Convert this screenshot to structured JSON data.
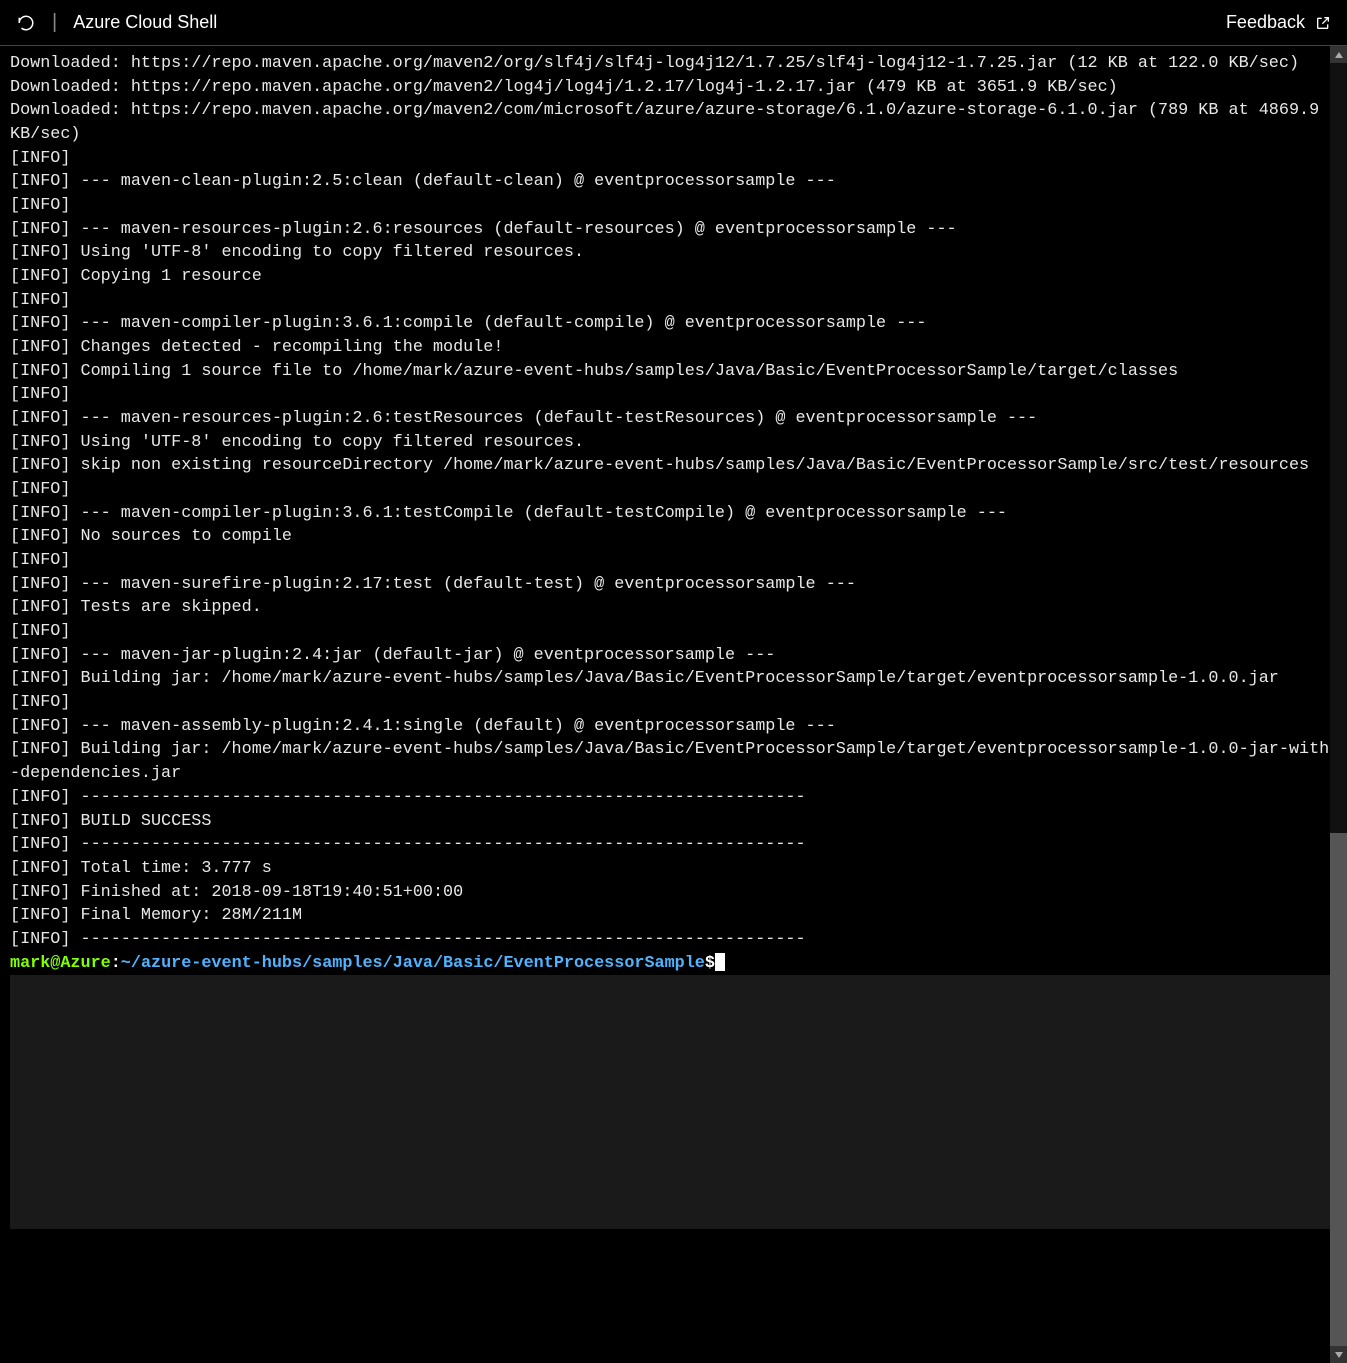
{
  "header": {
    "title": "Azure Cloud Shell",
    "feedback_label": "Feedback"
  },
  "terminal": {
    "lines": [
      "Downloaded: https://repo.maven.apache.org/maven2/org/slf4j/slf4j-log4j12/1.7.25/slf4j-log4j12-1.7.25.jar (12 KB at 122.0 KB/sec)",
      "Downloaded: https://repo.maven.apache.org/maven2/log4j/log4j/1.2.17/log4j-1.2.17.jar (479 KB at 3651.9 KB/sec)",
      "Downloaded: https://repo.maven.apache.org/maven2/com/microsoft/azure/azure-storage/6.1.0/azure-storage-6.1.0.jar (789 KB at 4869.9 KB/sec)",
      "[INFO]",
      "[INFO] --- maven-clean-plugin:2.5:clean (default-clean) @ eventprocessorsample ---",
      "[INFO]",
      "[INFO] --- maven-resources-plugin:2.6:resources (default-resources) @ eventprocessorsample ---",
      "[INFO] Using 'UTF-8' encoding to copy filtered resources.",
      "[INFO] Copying 1 resource",
      "[INFO]",
      "[INFO] --- maven-compiler-plugin:3.6.1:compile (default-compile) @ eventprocessorsample ---",
      "[INFO] Changes detected - recompiling the module!",
      "[INFO] Compiling 1 source file to /home/mark/azure-event-hubs/samples/Java/Basic/EventProcessorSample/target/classes",
      "[INFO]",
      "[INFO] --- maven-resources-plugin:2.6:testResources (default-testResources) @ eventprocessorsample ---",
      "[INFO] Using 'UTF-8' encoding to copy filtered resources.",
      "[INFO] skip non existing resourceDirectory /home/mark/azure-event-hubs/samples/Java/Basic/EventProcessorSample/src/test/resources",
      "[INFO]",
      "[INFO] --- maven-compiler-plugin:3.6.1:testCompile (default-testCompile) @ eventprocessorsample ---",
      "[INFO] No sources to compile",
      "[INFO]",
      "[INFO] --- maven-surefire-plugin:2.17:test (default-test) @ eventprocessorsample ---",
      "[INFO] Tests are skipped.",
      "[INFO]",
      "[INFO] --- maven-jar-plugin:2.4:jar (default-jar) @ eventprocessorsample ---",
      "[INFO] Building jar: /home/mark/azure-event-hubs/samples/Java/Basic/EventProcessorSample/target/eventprocessorsample-1.0.0.jar",
      "[INFO]",
      "[INFO] --- maven-assembly-plugin:2.4.1:single (default) @ eventprocessorsample ---",
      "[INFO] Building jar: /home/mark/azure-event-hubs/samples/Java/Basic/EventProcessorSample/target/eventprocessorsample-1.0.0-jar-with-dependencies.jar",
      "[INFO] ------------------------------------------------------------------------",
      "[INFO] BUILD SUCCESS",
      "[INFO] ------------------------------------------------------------------------",
      "[INFO] Total time: 3.777 s",
      "[INFO] Finished at: 2018-09-18T19:40:51+00:00",
      "[INFO] Final Memory: 28M/211M",
      "[INFO] ------------------------------------------------------------------------"
    ],
    "prompt": {
      "user_host": "mark@Azure",
      "colon": ":",
      "path": "~/azure-event-hubs/samples/Java/Basic/EventProcessorSample",
      "symbol": "$"
    }
  }
}
